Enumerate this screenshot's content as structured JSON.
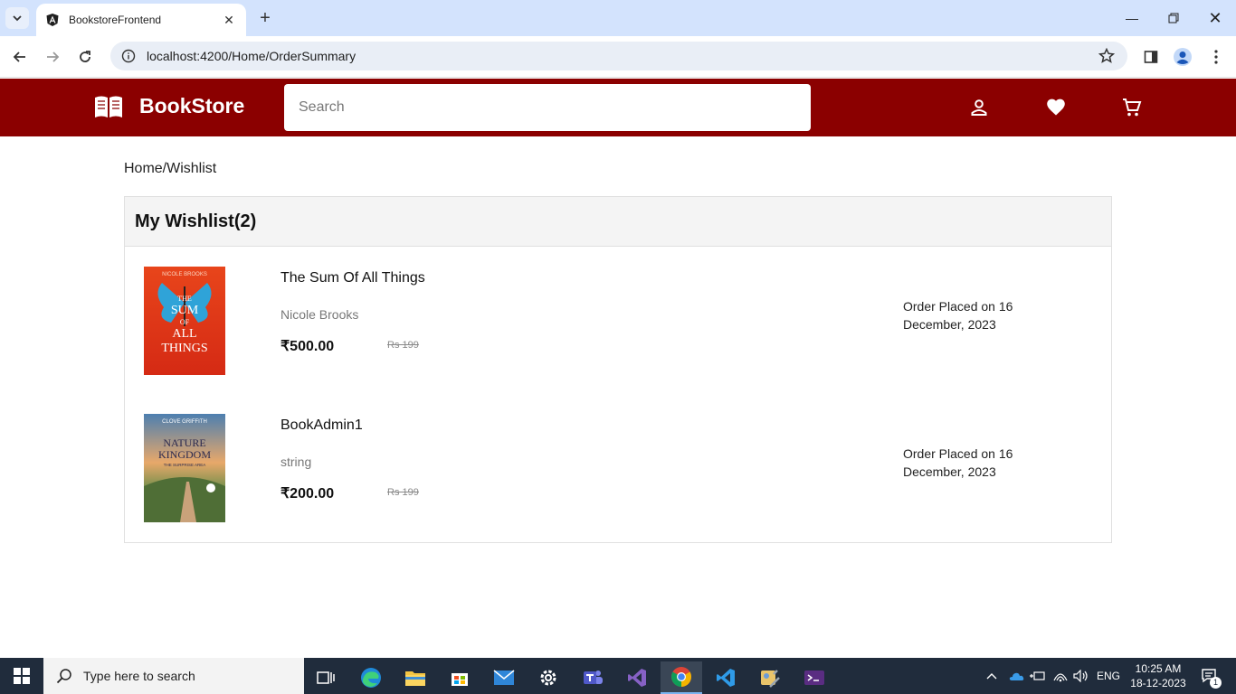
{
  "browser": {
    "tab_title": "BookstoreFrontend",
    "url": "localhost:4200/Home/OrderSummary"
  },
  "header": {
    "brand": "BookStore",
    "search_placeholder": "Search",
    "brand_color": "#8b0000"
  },
  "breadcrumb": "Home/Wishlist",
  "wishlist": {
    "title": "My Wishlist(2)",
    "items": [
      {
        "title": "The Sum Of All Things",
        "author": "Nicole Brooks",
        "price": "₹500.00",
        "old_price": "Rs 199",
        "order_date": "Order Placed on 16 December, 2023",
        "cover_author": "NICOLE BROOKS",
        "cover_lines": [
          "THE",
          "SUM",
          "OF",
          "ALL",
          "THINGS"
        ]
      },
      {
        "title": "BookAdmin1",
        "author": "string",
        "price": "₹200.00",
        "old_price": "Rs 199",
        "order_date": "Order Placed on 16 December, 2023",
        "cover_author": "CLOVE GRIFFITH",
        "cover_lines": [
          "NATURE",
          "KINGDOM"
        ],
        "cover_sub": "THE SURPRISE AREA"
      }
    ]
  },
  "taskbar": {
    "search_placeholder": "Type here to search",
    "language": "ENG",
    "time": "10:25 AM",
    "date": "18-12-2023",
    "notification_count": "1"
  }
}
